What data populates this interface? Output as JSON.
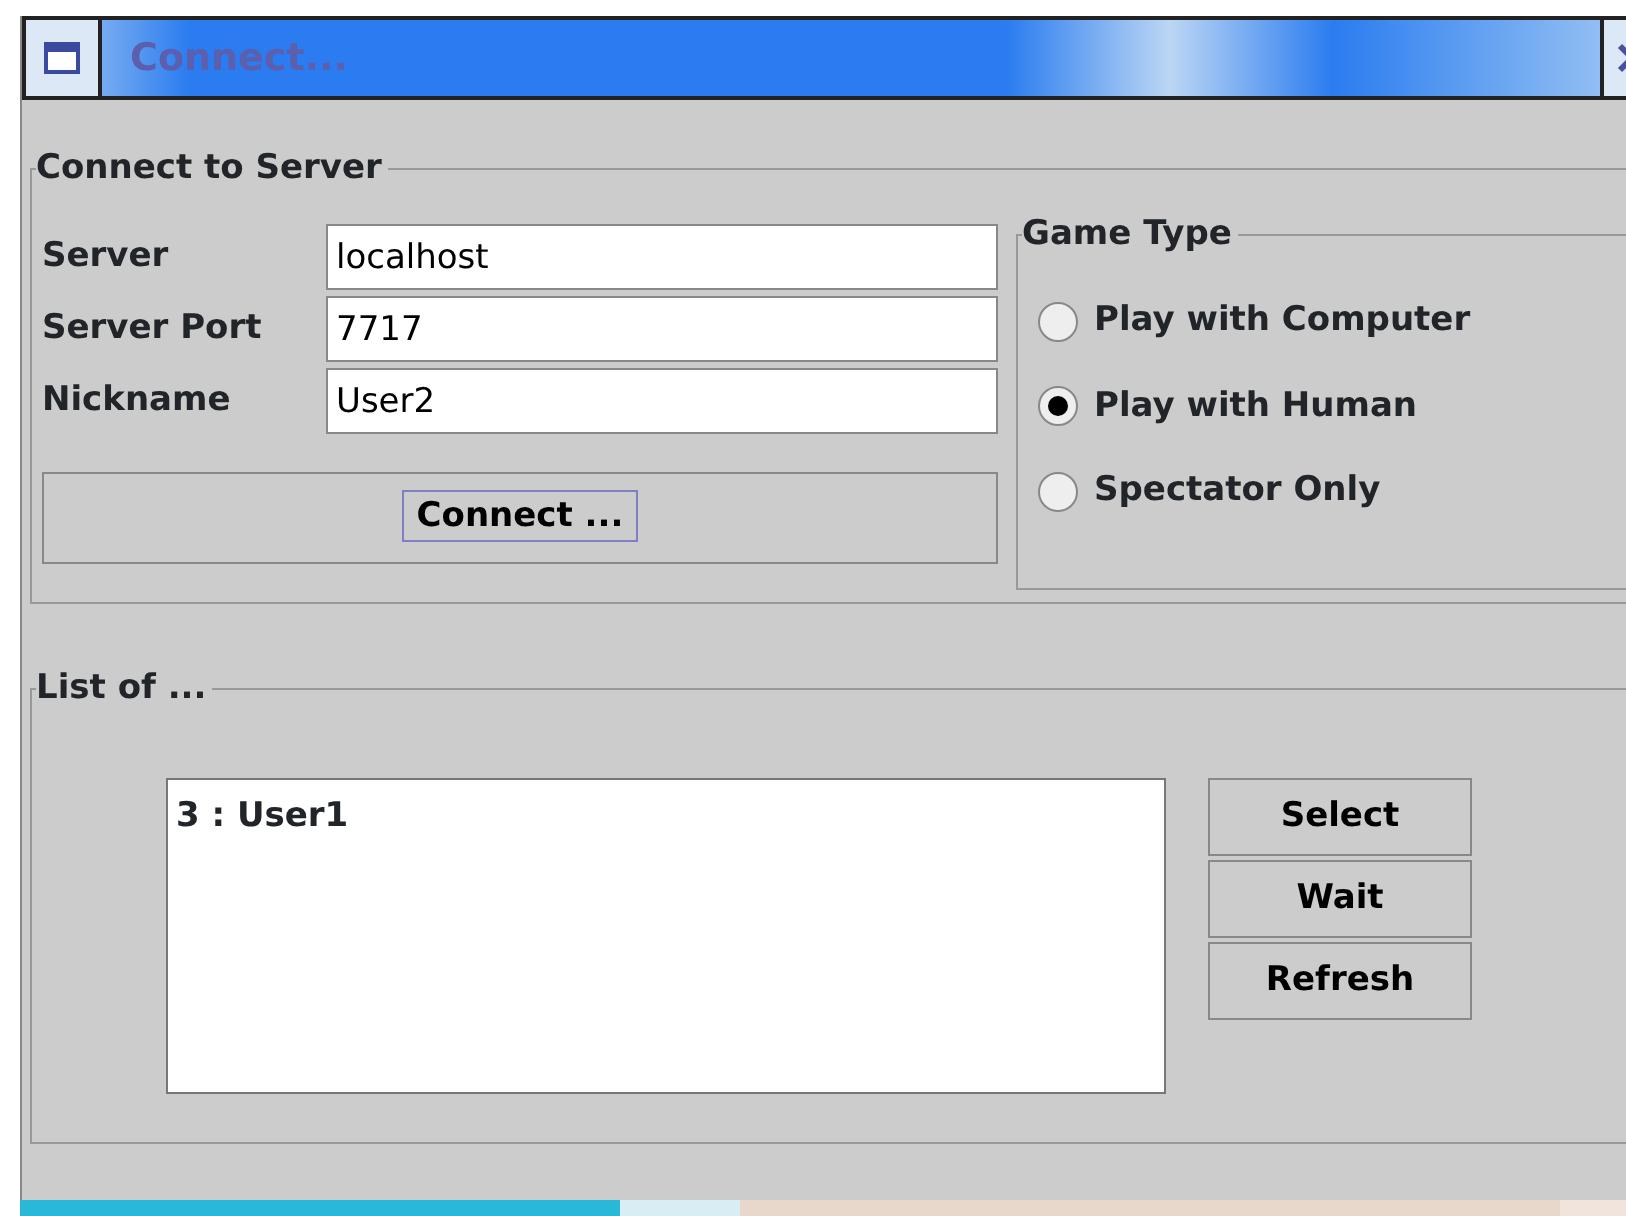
{
  "window": {
    "title": "Connect..."
  },
  "connect_group": {
    "title": "Connect to Server",
    "fields": [
      {
        "label": "Server",
        "value": "localhost"
      },
      {
        "label": "Server Port",
        "value": "7717"
      },
      {
        "label": "Nickname",
        "value": "User2"
      }
    ],
    "button": "Connect ..."
  },
  "game_type": {
    "title": "Game Type",
    "options": [
      {
        "label": "Play with Computer",
        "selected": false
      },
      {
        "label": "Play with Human",
        "selected": true
      },
      {
        "label": "Spectator Only",
        "selected": false
      }
    ]
  },
  "list_group": {
    "title": "List of ...",
    "items": [
      {
        "text": "3 : User1",
        "selected": false
      }
    ],
    "buttons": [
      "Select",
      "Wait",
      "Refresh"
    ]
  }
}
